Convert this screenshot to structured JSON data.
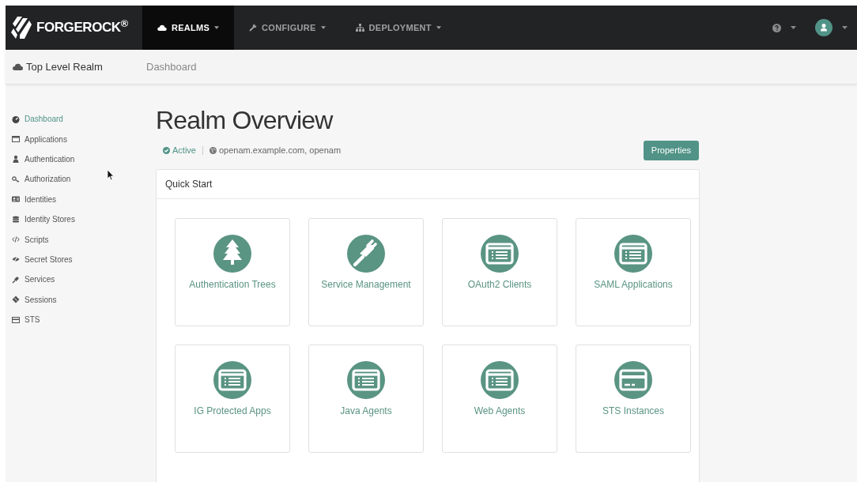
{
  "navbar": {
    "logo": "FORGEROCK$^{®}$",
    "menus": [
      {
        "label": "REALMS",
        "selected": true
      },
      {
        "label": "CONFIGURE",
        "selected": false
      },
      {
        "label": "DEPLOYMENT",
        "selected": false
      }
    ]
  },
  "breadcrumb": {
    "realm": "Top Level Realm",
    "page": "Dashboard"
  },
  "sidebar": {
    "items": [
      {
        "label": "Dashboard",
        "selected": true
      },
      {
        "label": "Applications",
        "selected": false
      },
      {
        "label": "Authentication",
        "selected": false
      },
      {
        "label": "Authorization",
        "selected": false
      },
      {
        "label": "Identities",
        "selected": false
      },
      {
        "label": "Identity Stores",
        "selected": false
      },
      {
        "label": "Scripts",
        "selected": false
      },
      {
        "label": "Secret Stores",
        "selected": false
      },
      {
        "label": "Services",
        "selected": false
      },
      {
        "label": "Sessions",
        "selected": false
      },
      {
        "label": "STS",
        "selected": false
      }
    ]
  },
  "header": {
    "title": "Realm Overview",
    "status": "Active",
    "dns": "openam.example.com, openam",
    "button": "Properties"
  },
  "quick_start": {
    "title": "Quick Start",
    "cards": [
      {
        "label": "Authentication Trees",
        "kind": "tree"
      },
      {
        "label": "Service Management",
        "kind": "plug"
      },
      {
        "label": "OAuth2 Clients",
        "kind": "window"
      },
      {
        "label": "SAML Applications",
        "kind": "window"
      },
      {
        "label": "IG Protected Apps",
        "kind": "window"
      },
      {
        "label": "Java Agents",
        "kind": "window"
      },
      {
        "label": "Web Agents",
        "kind": "window"
      },
      {
        "label": "STS Instances",
        "kind": "card"
      }
    ]
  }
}
